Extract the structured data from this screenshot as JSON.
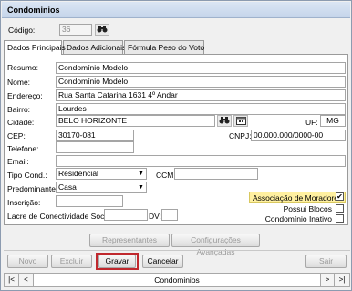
{
  "window": {
    "title": "Condominios"
  },
  "header": {
    "codigo_label": "Código:",
    "codigo_value": "36"
  },
  "tabs": [
    {
      "label": "Dados Principais"
    },
    {
      "label": "Dados Adicionais"
    },
    {
      "label": "Fórmula Peso do Voto"
    }
  ],
  "form": {
    "resumo_label": "Resumo:",
    "resumo_value": "Condomínio Modelo",
    "nome_label": "Nome:",
    "nome_value": "Condomínio Modelo",
    "endereco_label": "Endereço:",
    "endereco_value": "Rua Santa Catarina 1631 4º Andar",
    "bairro_label": "Bairro:",
    "bairro_value": "Lourdes",
    "cidade_label": "Cidade:",
    "cidade_value": "BELO HORIZONTE",
    "uf_label": "UF:",
    "uf_value": "MG",
    "cep_label": "CEP:",
    "cep_value": "30170-081",
    "cnpj_label": "CNPJ:",
    "cnpj_value": "00.000.000/0000-00",
    "telefone_label": "Telefone:",
    "telefone_value": "",
    "email_label": "Email:",
    "email_value": "",
    "tipo_label": "Tipo Cond.:",
    "tipo_value": "Residencial",
    "ccm_label": "CCM:",
    "ccm_value": "",
    "predominante_label": "Predominante:",
    "predominante_value": "Casa",
    "inscricao_label": "Inscrição:",
    "inscricao_value": "",
    "lacre_label": "Lacre de Conectividade Social:",
    "lacre_value": "",
    "dv_label": "DV:",
    "dv_value": ""
  },
  "checkboxes": [
    {
      "label": "Associação de Moradores",
      "checked": true,
      "highlight": "#fff0a0"
    },
    {
      "label": "Possui Blocos",
      "checked": false
    },
    {
      "label": "Condomínio Inativo",
      "checked": false
    }
  ],
  "actions": {
    "representantes": "Representantes",
    "configuracoes": "Configurações Avançadas"
  },
  "toolbar": {
    "novo_pre": "",
    "novo_u": "N",
    "novo_post": "ovo",
    "excluir_pre": "",
    "excluir_u": "E",
    "excluir_post": "xcluir",
    "gravar_pre": "",
    "gravar_u": "G",
    "gravar_post": "ravar",
    "cancelar_pre": "",
    "cancelar_u": "C",
    "cancelar_post": "ancelar",
    "sair_pre": "",
    "sair_u": "S",
    "sair_post": "air",
    "gravar_highlight": "#c0282d"
  },
  "navigator": {
    "first": "|<",
    "prev": "<",
    "label": "Condominios",
    "next": ">",
    "last": ">|"
  },
  "icons": {
    "binoculars": "binoculars-icon",
    "calendar": "calendar-icon",
    "dropdown": "chevron-down-icon",
    "check": "checkmark-icon"
  }
}
